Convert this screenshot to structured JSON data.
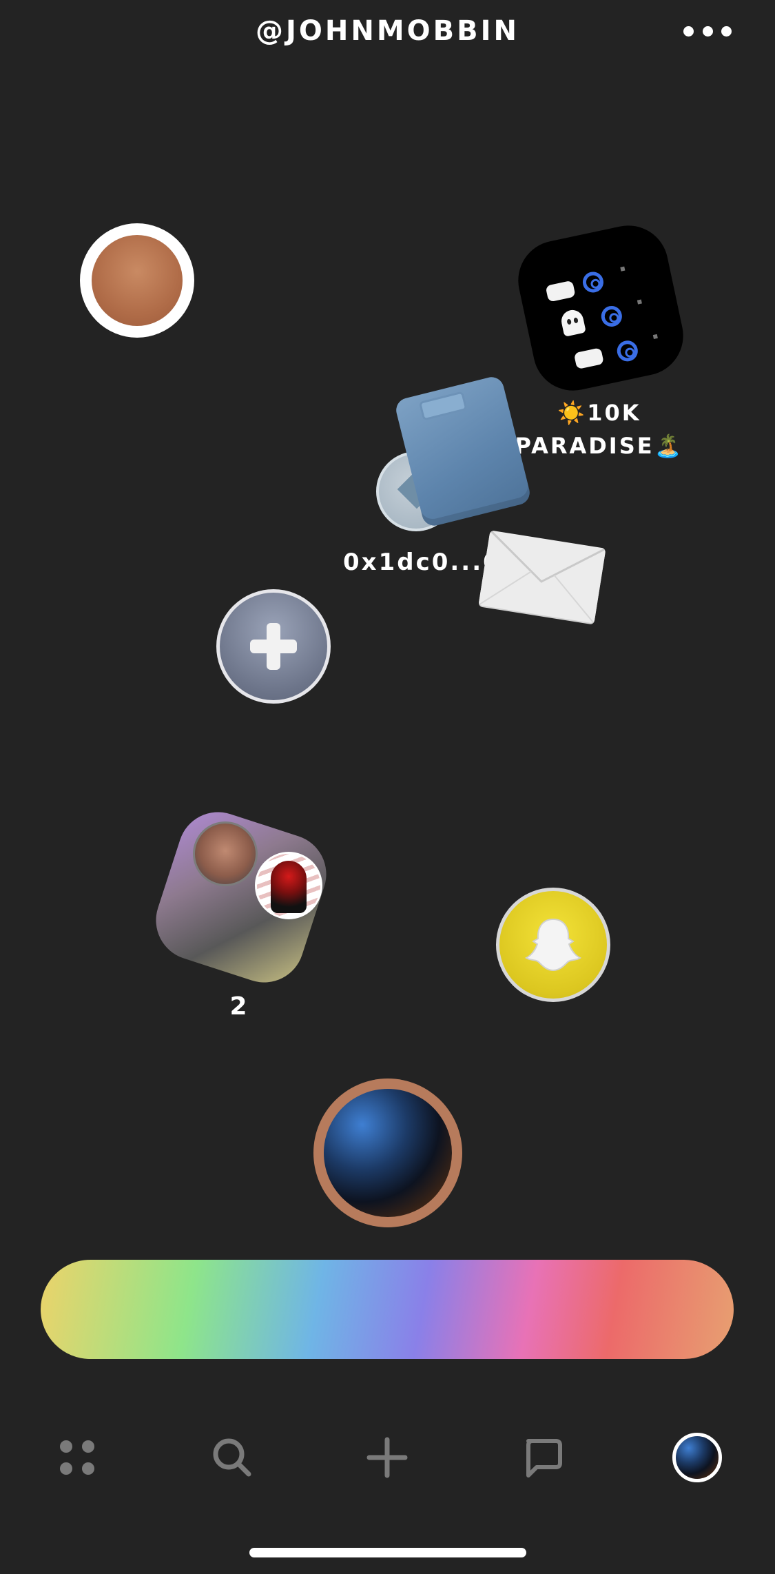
{
  "header": {
    "handle": "@JOHNMOBBIN",
    "more_icon": "more-horizontal-icon"
  },
  "items": {
    "app_label": "☀️10K PARADISE🏝️",
    "wallet_address": "0x1dc0...0",
    "group_count": "2"
  },
  "icons": {
    "profile": "profile-circle-icon",
    "app": "app-square-icon",
    "wallet": "wallet-icon",
    "coin": "ethereum-coin-icon",
    "envelope": "envelope-icon",
    "add": "plus-icon",
    "snapchat": "snapchat-ghost-icon",
    "orb": "orb-icon"
  },
  "nav": {
    "items": [
      {
        "icon": "apps-grid-icon"
      },
      {
        "icon": "search-icon"
      },
      {
        "icon": "plus-icon"
      },
      {
        "icon": "chat-icon"
      },
      {
        "icon": "avatar-icon"
      }
    ]
  },
  "colors": {
    "background": "#232323",
    "text": "#ffffff",
    "nav_icon": "#7a7a7a",
    "rainbow": [
      "#ecd36a",
      "#8ee58a",
      "#6fb5e6",
      "#8a80e8",
      "#e872b6",
      "#ec6a6a",
      "#e7a071"
    ]
  }
}
